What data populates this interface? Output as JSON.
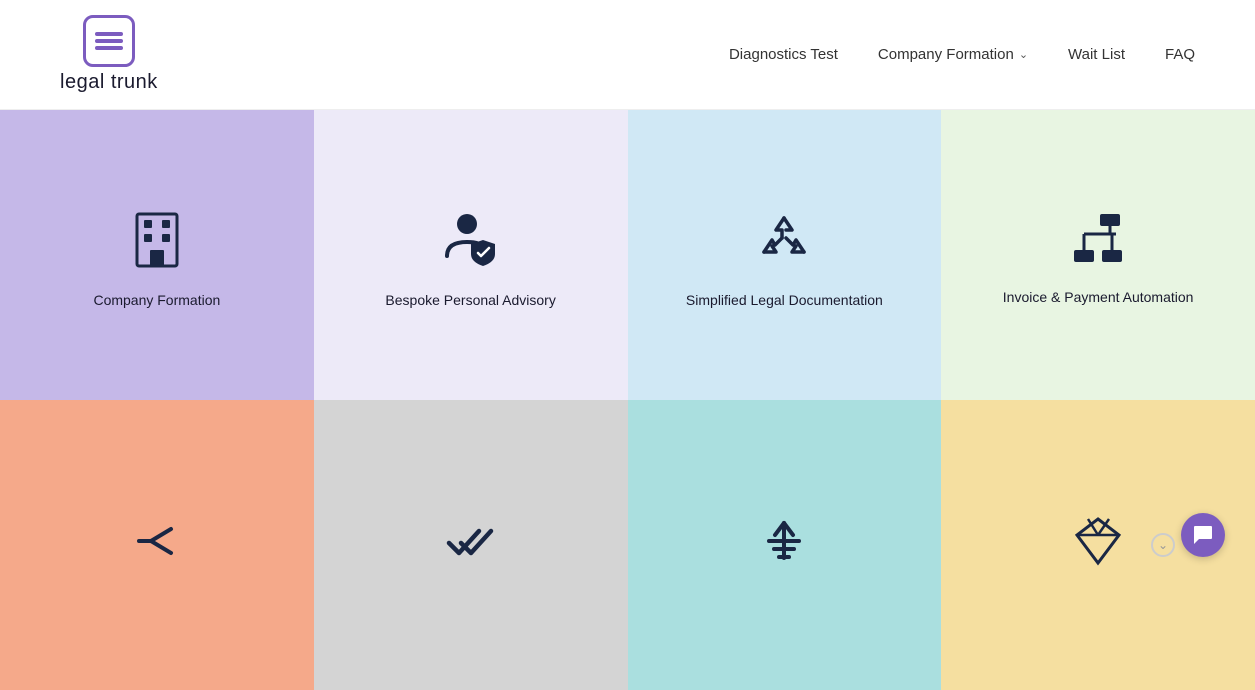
{
  "header": {
    "logo_text": "legal trunk",
    "nav": {
      "items": [
        {
          "label": "Diagnostics Test",
          "dropdown": false
        },
        {
          "label": "Company Formation",
          "dropdown": true
        },
        {
          "label": "Wait List",
          "dropdown": false
        },
        {
          "label": "FAQ",
          "dropdown": false
        }
      ]
    }
  },
  "grid": {
    "top_row": [
      {
        "label": "Company Formation",
        "icon": "building",
        "bg": "card-purple"
      },
      {
        "label": "Bespoke Personal Advisory",
        "icon": "person-shield",
        "bg": "card-light-purple"
      },
      {
        "label": "Simplified Legal Documentation",
        "icon": "recycle",
        "bg": "card-light-blue"
      },
      {
        "label": "Invoice & Payment Automation",
        "icon": "flow-chart",
        "bg": "card-light-green"
      }
    ],
    "bottom_row": [
      {
        "label": "",
        "icon": "share",
        "bg": "card-peach"
      },
      {
        "label": "",
        "icon": "double-check",
        "bg": "card-gray"
      },
      {
        "label": "",
        "icon": "sort",
        "bg": "card-teal"
      },
      {
        "label": "",
        "icon": "diamond",
        "bg": "card-cream"
      }
    ]
  }
}
